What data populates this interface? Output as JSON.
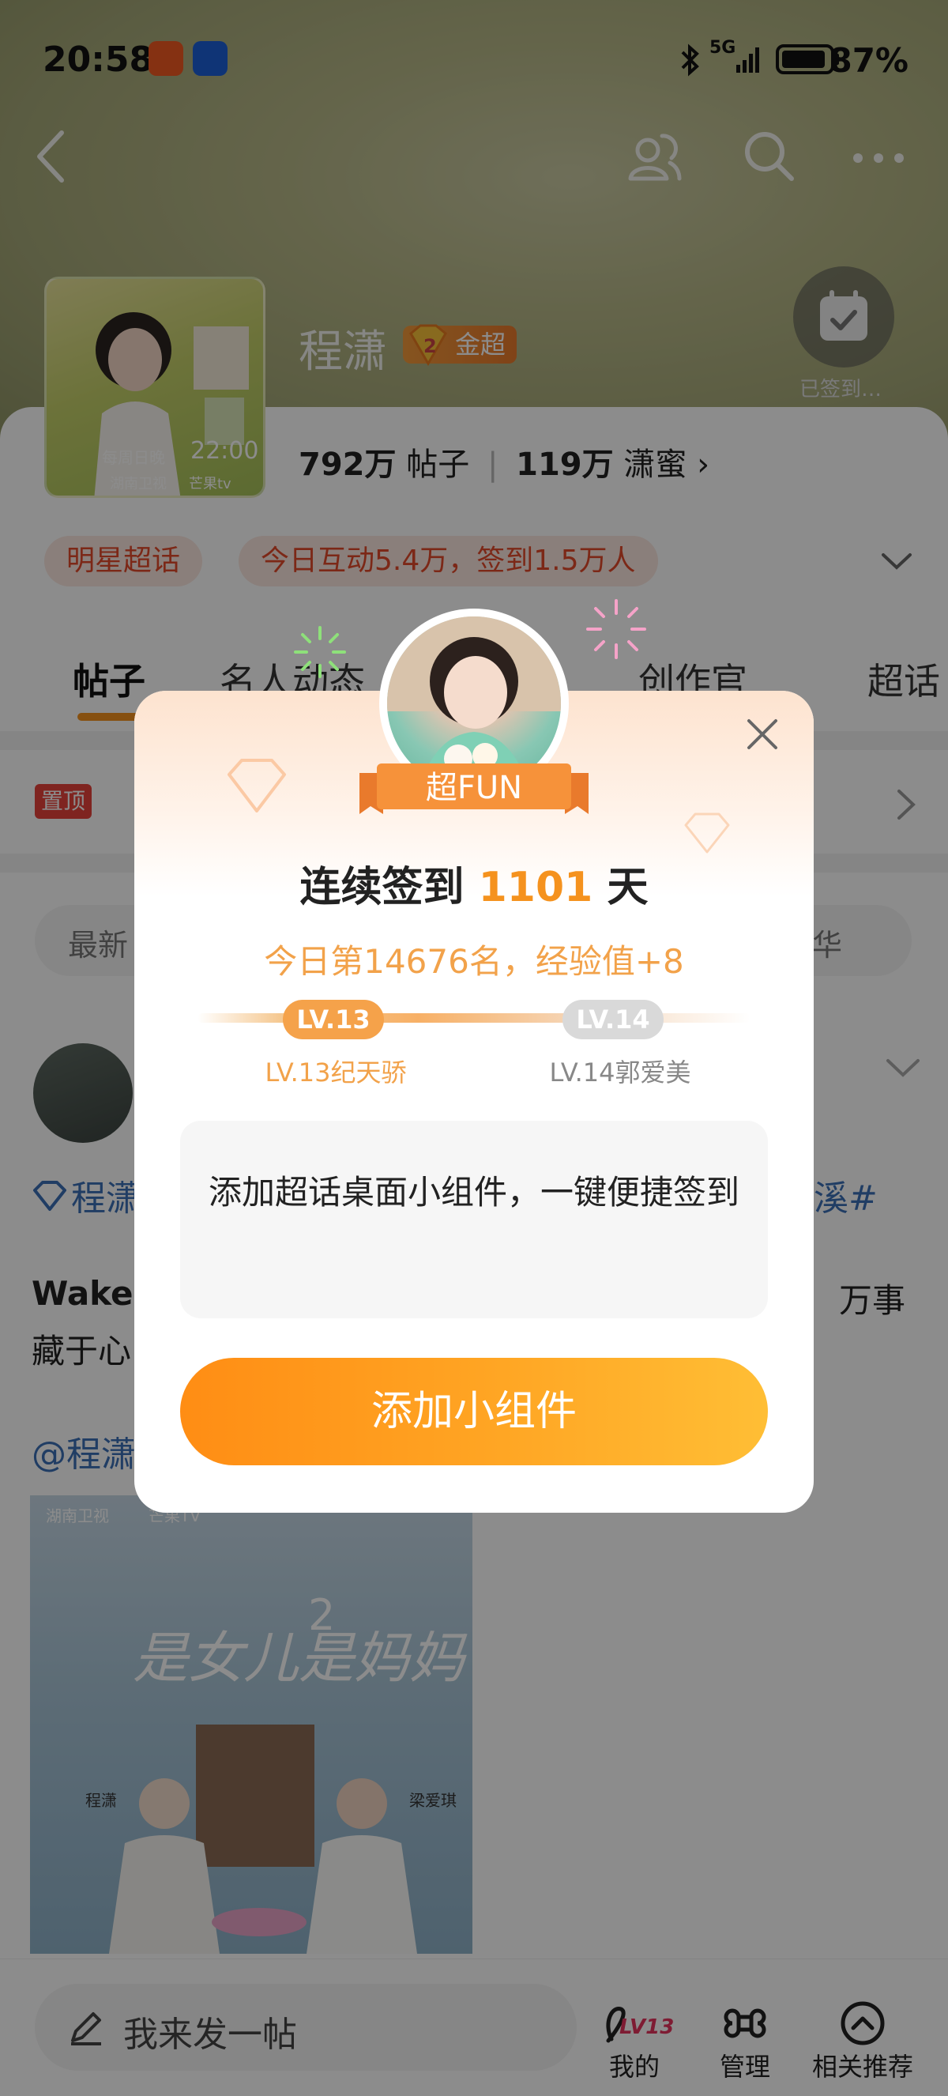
{
  "status_bar": {
    "time": "20:58",
    "network": "5G",
    "battery": "87%"
  },
  "profile": {
    "name": "程潇",
    "badge": "金超",
    "badge_level": "2",
    "stats": {
      "posts_count": "792万",
      "posts_label": "帖子",
      "fans_count": "119万",
      "fans_label": "潇蜜",
      "chevron": "›"
    },
    "poster_text": {
      "schedule": "每周日晚",
      "time": "22:00",
      "channel": "湖南卫视",
      "platform": "芒果tv"
    },
    "checkin_overflow_text": "已签到…"
  },
  "chips": {
    "star": "明星超话",
    "activity": "今日互动5.4万，签到1.5万人"
  },
  "tabs": [
    {
      "label": "帖子"
    },
    {
      "label": "名人动态"
    },
    {
      "label": "创作官"
    },
    {
      "label": "超话"
    }
  ],
  "pinned": {
    "badge": "置顶"
  },
  "filter": {
    "left": "最新",
    "right": "华"
  },
  "post": {
    "topic_prefix": "程潇",
    "topic_suffix": "溪#",
    "line1_left": "Wake",
    "line1_right": "万事",
    "line2": "藏于心",
    "mention": "@程潇",
    "poster": {
      "title": "是女儿是妈妈",
      "title_num": "2",
      "channel": "湖南卫视",
      "platform": "芒果TV",
      "actor1": "程潇",
      "actor2": "梁爱琪"
    }
  },
  "bottom_bar": {
    "compose_placeholder": "我来发一帖",
    "nav": [
      {
        "label": "我的",
        "icon": "lv13-icon",
        "badge": "LV13"
      },
      {
        "label": "管理",
        "icon": "command-icon"
      },
      {
        "label": "相关推荐",
        "icon": "up-circle-icon"
      }
    ]
  },
  "modal": {
    "ribbon": "超FUN",
    "streak_prefix": "连续签到",
    "streak_days": "1101",
    "streak_suffix": "天",
    "rank_text": "今日第14676名，经验值+8",
    "current_level": "LV.13",
    "next_level": "LV.14",
    "current_level_name": "LV.13纪天骄",
    "next_level_name": "LV.14郭爱美",
    "widget_text": "添加超话桌面小组件，一键便捷签到",
    "button": "添加小组件"
  },
  "colors": {
    "accent": "#f5921e",
    "button_start": "#ff8d14",
    "button_end": "#ffbe35",
    "chip_text": "#e24a2b",
    "link": "#3b6fb7"
  }
}
